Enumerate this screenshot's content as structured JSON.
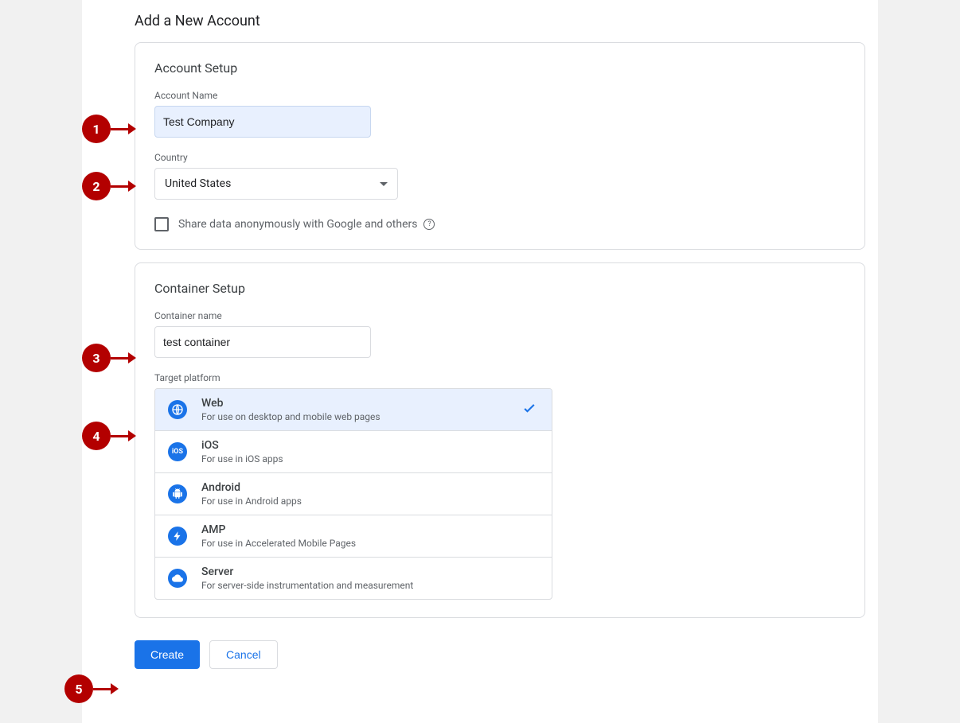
{
  "page": {
    "title": "Add a New Account"
  },
  "account": {
    "card_title": "Account Setup",
    "name_label": "Account Name",
    "name_value": "Test Company",
    "country_label": "Country",
    "country_value": "United States",
    "share_label": "Share data anonymously with Google and others"
  },
  "container": {
    "card_title": "Container Setup",
    "name_label": "Container name",
    "name_value": "test container",
    "platform_label": "Target platform",
    "platforms": [
      {
        "name": "Web",
        "desc": "For use on desktop and mobile web pages",
        "selected": true,
        "icon": "globe-icon"
      },
      {
        "name": "iOS",
        "desc": "For use in iOS apps",
        "selected": false,
        "icon": "ios-icon"
      },
      {
        "name": "Android",
        "desc": "For use in Android apps",
        "selected": false,
        "icon": "android-icon"
      },
      {
        "name": "AMP",
        "desc": "For use in Accelerated Mobile Pages",
        "selected": false,
        "icon": "amp-icon"
      },
      {
        "name": "Server",
        "desc": "For server-side instrumentation and measurement",
        "selected": false,
        "icon": "server-icon"
      }
    ]
  },
  "buttons": {
    "create": "Create",
    "cancel": "Cancel"
  },
  "markers": {
    "1": "1",
    "2": "2",
    "3": "3",
    "4": "4",
    "5": "5"
  }
}
